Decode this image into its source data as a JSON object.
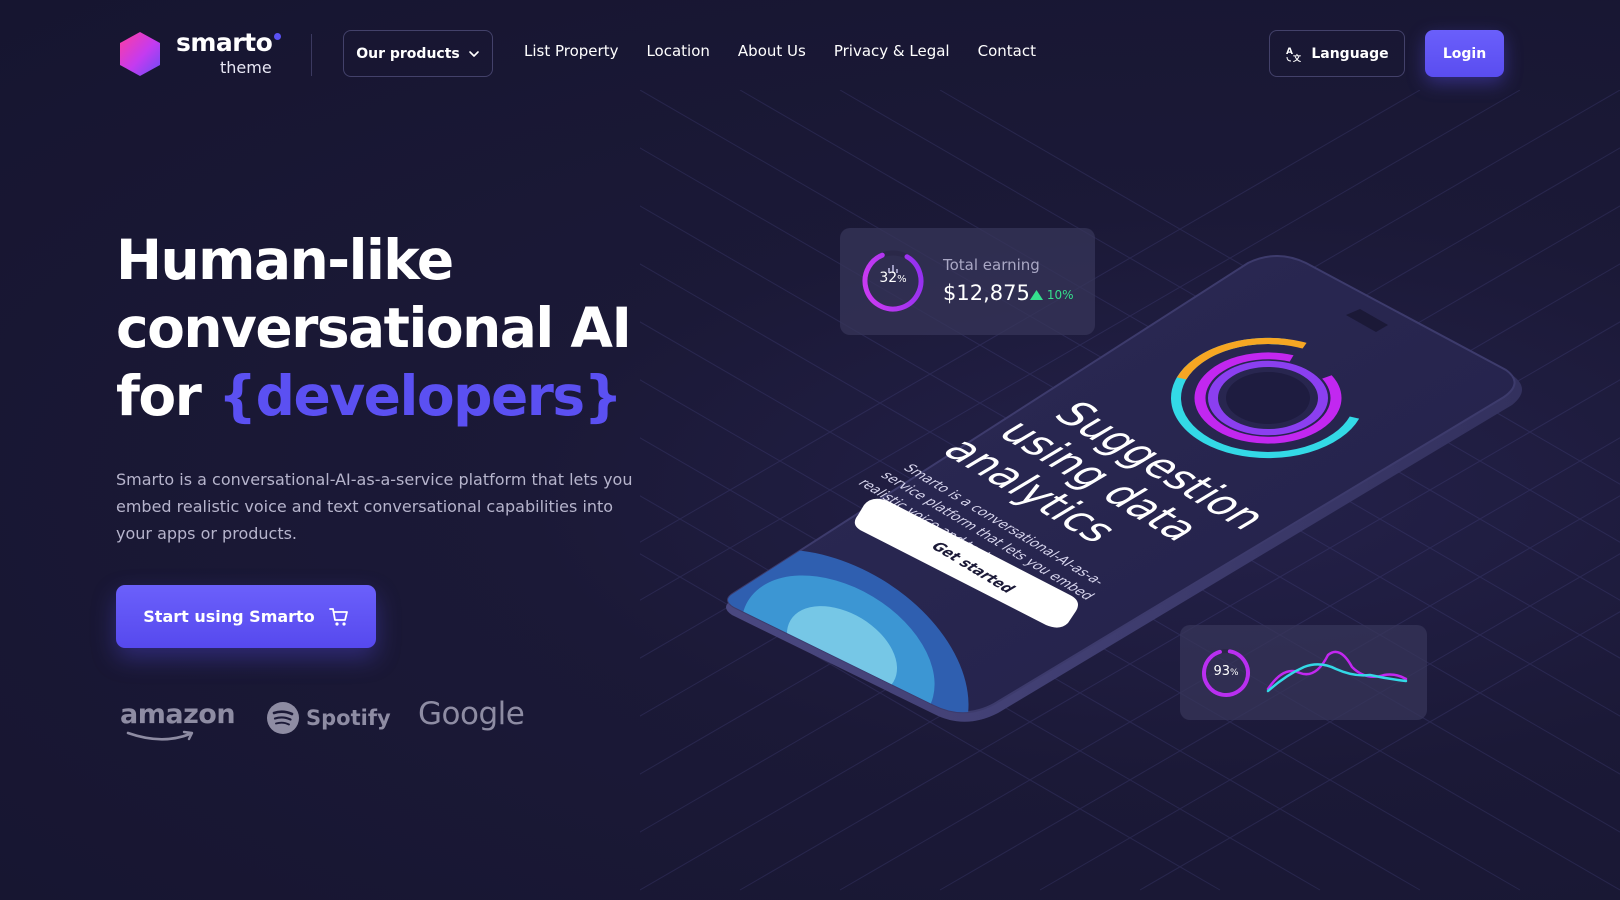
{
  "brand": {
    "name": "smarto",
    "subtitle": "theme"
  },
  "header": {
    "products_label": "Our products",
    "nav": [
      "List Property",
      "Location",
      "About Us",
      "Privacy & Legal",
      "Contact"
    ],
    "language_label": "Language",
    "login_label": "Login"
  },
  "hero": {
    "title_line1": "Human-like",
    "title_line2": "conversational AI",
    "title_line3_prefix": "for",
    "title_accent": "{developers}",
    "description": "Smarto is a conversational-AI-as-a-service platform that lets you embed realistic voice and text conversational capabilities into your apps or products.",
    "cta_label": "Start using Smarto"
  },
  "brands": [
    "amazon",
    "Spotify",
    "Google"
  ],
  "earning_card": {
    "ring_value": "32",
    "ring_unit": "%",
    "label": "Total earning",
    "value": "$12,875",
    "delta": "10%"
  },
  "stats_card": {
    "ring_value": "93",
    "ring_unit": "%"
  },
  "phone": {
    "title_line1": "Suggestion",
    "title_line2": "using data",
    "title_line3": "analytics",
    "body_line1": "Smarto is a conversational-AI-as-a-",
    "body_line2": "service platform that lets you embed",
    "body_line3": "realistic voice and text.",
    "button_label": "Get started"
  },
  "colors": {
    "background": "#1b1937",
    "accent": "#5b50f2",
    "success": "#35e08d",
    "ring_magenta": "#c227f0",
    "ring_cyan": "#33d9e6",
    "ring_orange": "#f6a623"
  }
}
